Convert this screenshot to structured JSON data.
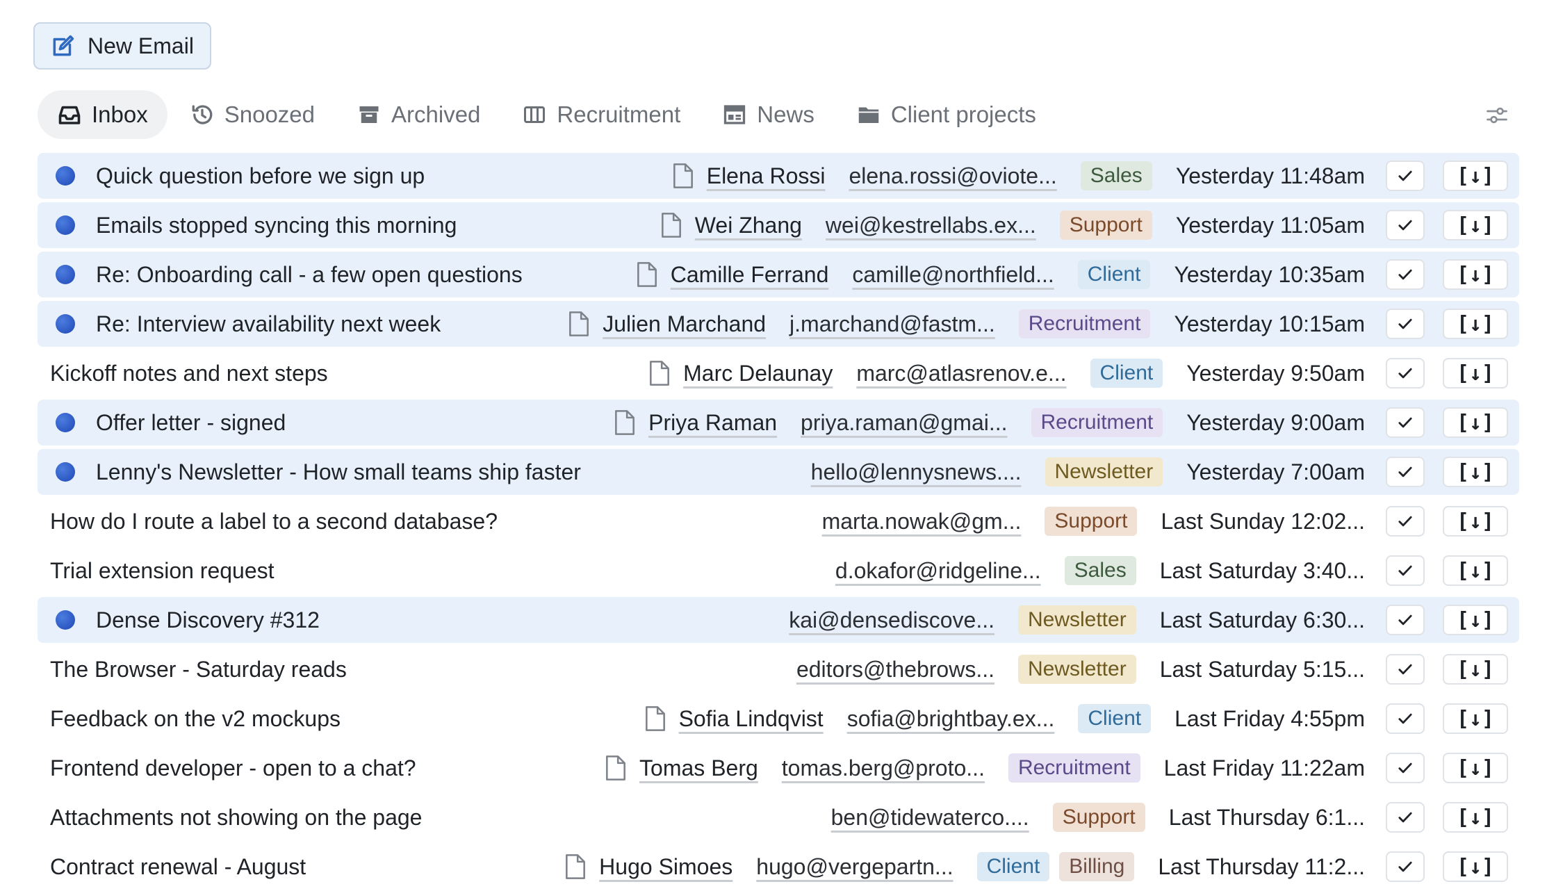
{
  "toolbar": {
    "new_email_label": "New Email"
  },
  "tabs": [
    {
      "label": "Inbox",
      "icon": "inbox-icon",
      "active": true
    },
    {
      "label": "Snoozed",
      "icon": "snooze-icon",
      "active": false
    },
    {
      "label": "Archived",
      "icon": "archive-box-icon",
      "active": false
    },
    {
      "label": "Recruitment",
      "icon": "columns-icon",
      "active": false
    },
    {
      "label": "News",
      "icon": "newspaper-icon",
      "active": false
    },
    {
      "label": "Client projects",
      "icon": "folder-icon",
      "active": false
    }
  ],
  "emails": [
    {
      "subject": "Quick question before we sign up",
      "sender_name": "Elena Rossi",
      "sender_email": "elena.rossi@oviote...",
      "tags": [
        "Sales"
      ],
      "time": "Yesterday 11:48am",
      "unread": true,
      "attachment": true
    },
    {
      "subject": "Emails stopped syncing this morning",
      "sender_name": "Wei Zhang",
      "sender_email": "wei@kestrellabs.ex...",
      "tags": [
        "Support"
      ],
      "time": "Yesterday 11:05am",
      "unread": true,
      "attachment": true
    },
    {
      "subject": "Re: Onboarding call - a few open questions",
      "sender_name": "Camille Ferrand",
      "sender_email": "camille@northfield...",
      "tags": [
        "Client"
      ],
      "time": "Yesterday 10:35am",
      "unread": true,
      "attachment": true
    },
    {
      "subject": "Re: Interview availability next week",
      "sender_name": "Julien Marchand",
      "sender_email": "j.marchand@fastm...",
      "tags": [
        "Recruitment"
      ],
      "time": "Yesterday 10:15am",
      "unread": true,
      "attachment": true
    },
    {
      "subject": "Kickoff notes and next steps",
      "sender_name": "Marc Delaunay",
      "sender_email": "marc@atlasrenov.e...",
      "tags": [
        "Client"
      ],
      "time": "Yesterday 9:50am",
      "unread": false,
      "attachment": true
    },
    {
      "subject": "Offer letter - signed",
      "sender_name": "Priya Raman",
      "sender_email": "priya.raman@gmai...",
      "tags": [
        "Recruitment"
      ],
      "time": "Yesterday 9:00am",
      "unread": true,
      "attachment": true
    },
    {
      "subject": "Lenny's Newsletter - How small teams ship faster",
      "sender_name": "",
      "sender_email": "hello@lennysnews....",
      "tags": [
        "Newsletter"
      ],
      "time": "Yesterday 7:00am",
      "unread": true,
      "attachment": false
    },
    {
      "subject": "How do I route a label to a second database?",
      "sender_name": "",
      "sender_email": "marta.nowak@gm...",
      "tags": [
        "Support"
      ],
      "time": "Last Sunday 12:02...",
      "unread": false,
      "attachment": false
    },
    {
      "subject": "Trial extension request",
      "sender_name": "",
      "sender_email": "d.okafor@ridgeline...",
      "tags": [
        "Sales"
      ],
      "time": "Last Saturday 3:40...",
      "unread": false,
      "attachment": false
    },
    {
      "subject": "Dense Discovery #312",
      "sender_name": "",
      "sender_email": "kai@densediscove...",
      "tags": [
        "Newsletter"
      ],
      "time": "Last Saturday 6:30...",
      "unread": true,
      "attachment": false
    },
    {
      "subject": "The Browser - Saturday reads",
      "sender_name": "",
      "sender_email": "editors@thebrows...",
      "tags": [
        "Newsletter"
      ],
      "time": "Last Saturday 5:15...",
      "unread": false,
      "attachment": false
    },
    {
      "subject": "Feedback on the v2 mockups",
      "sender_name": "Sofia Lindqvist",
      "sender_email": "sofia@brightbay.ex...",
      "tags": [
        "Client"
      ],
      "time": "Last Friday 4:55pm",
      "unread": false,
      "attachment": true
    },
    {
      "subject": "Frontend developer - open to a chat?",
      "sender_name": "Tomas Berg",
      "sender_email": "tomas.berg@proto...",
      "tags": [
        "Recruitment"
      ],
      "time": "Last Friday 11:22am",
      "unread": false,
      "attachment": true
    },
    {
      "subject": "Attachments not showing on the page",
      "sender_name": "",
      "sender_email": "ben@tidewaterco....",
      "tags": [
        "Support"
      ],
      "time": "Last Thursday 6:1...",
      "unread": false,
      "attachment": false
    },
    {
      "subject": "Contract renewal - August",
      "sender_name": "Hugo Simoes",
      "sender_email": "hugo@vergepartn...",
      "tags": [
        "Client",
        "Billing"
      ],
      "time": "Last Thursday 11:2...",
      "unread": false,
      "attachment": true
    }
  ],
  "actions": {
    "done_glyph": "✓",
    "archive_glyph": "[↓]"
  }
}
